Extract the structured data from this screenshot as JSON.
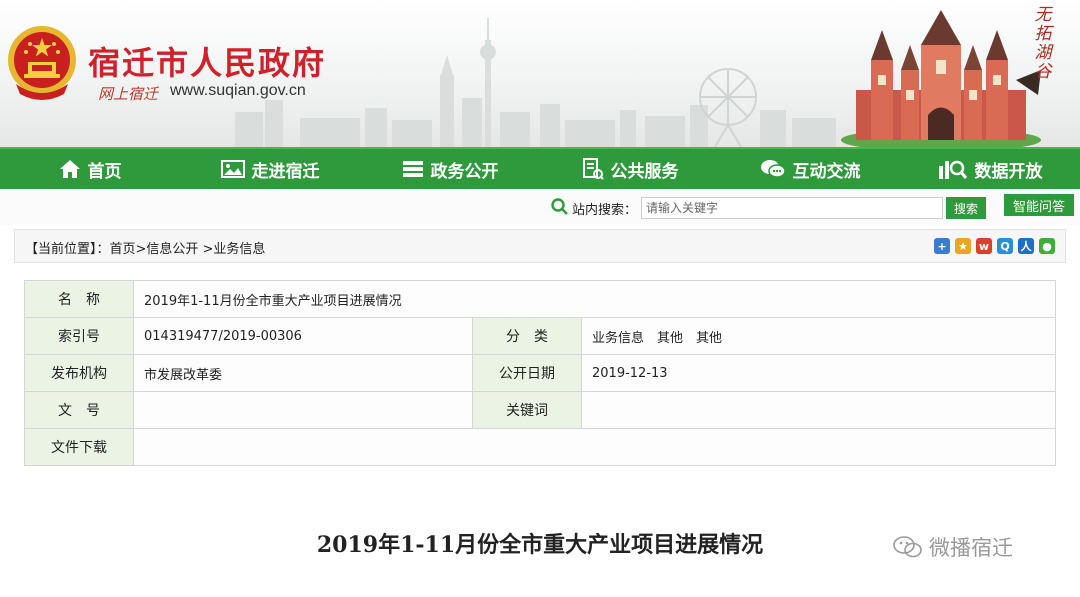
{
  "header": {
    "site_title": "宿迁市人民政府",
    "slogan": "网上宿迁",
    "url": "www.suqian.gov.cn",
    "calligraphy": "无拓湖谷"
  },
  "nav": {
    "items": [
      {
        "label": "首页",
        "icon": "home-icon"
      },
      {
        "label": "走进宿迁",
        "icon": "picture-icon"
      },
      {
        "label": "政务公开",
        "icon": "stack-icon"
      },
      {
        "label": "公共服务",
        "icon": "service-icon"
      },
      {
        "label": "互动交流",
        "icon": "chat-icon"
      },
      {
        "label": "数据开放",
        "icon": "data-icon"
      }
    ]
  },
  "search": {
    "label": "站内搜索：",
    "placeholder": "请输入关键字",
    "button": "搜索",
    "qa_button": "智能问答"
  },
  "breadcrumb": "【当前位置】：首页>信息公开 >业务信息",
  "share_icons": [
    "add-share-icon",
    "star-share-icon",
    "weibo-share-icon",
    "qzone-share-icon",
    "renren-share-icon",
    "wechat-share-icon"
  ],
  "info": {
    "name_label": "名　称",
    "name_value": "2019年1-11月份全市重大产业项目进展情况",
    "index_label": "索引号",
    "index_value": "014319477/2019-00306",
    "category_label": "分　类",
    "category_value": "业务信息　其他　其他",
    "publisher_label": "发布机构",
    "publisher_value": "市发展改革委",
    "date_label": "公开日期",
    "date_value": "2019-12-13",
    "docno_label": "文　号",
    "docno_value": "",
    "keywords_label": "关键词",
    "keywords_value": "",
    "download_label": "文件下载",
    "download_value": ""
  },
  "article": {
    "title": "2019年1-11月份全市重大产业项目进展情况"
  },
  "watermark": "微播宿迁",
  "colors": {
    "nav_green": "#2e9a3c",
    "title_red": "#d0212a",
    "label_bg": "#ebf3e5"
  }
}
